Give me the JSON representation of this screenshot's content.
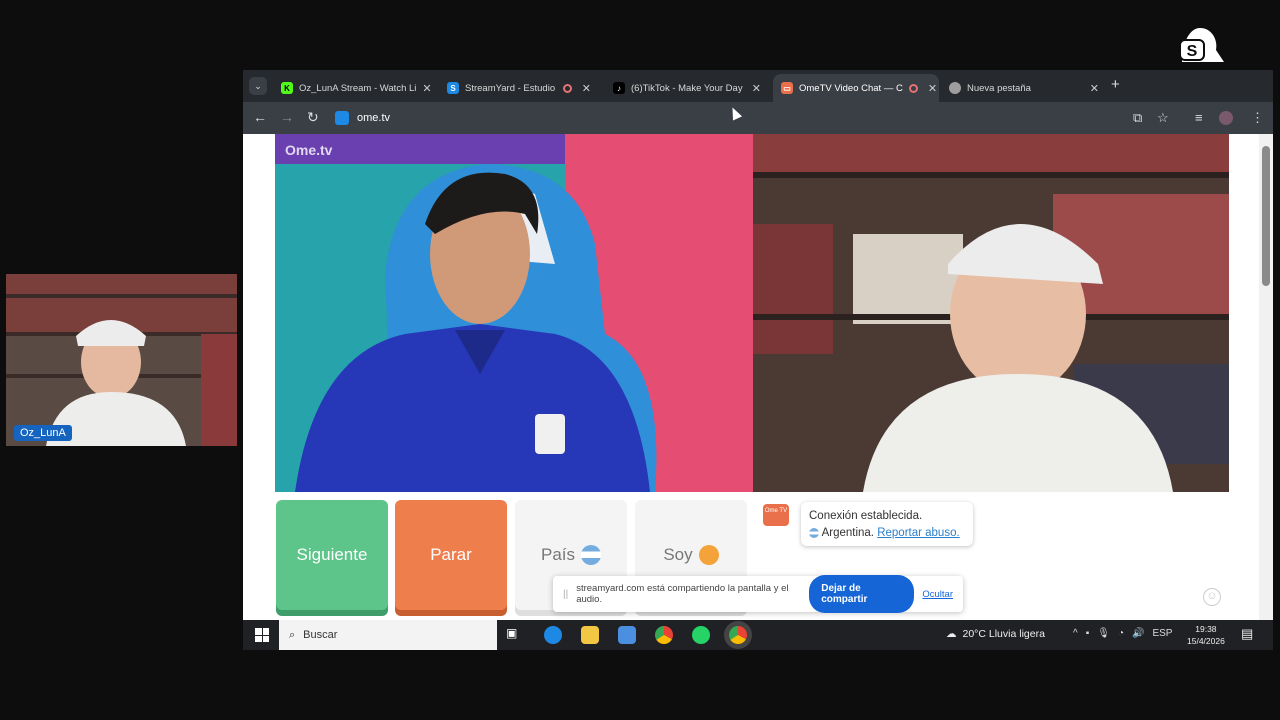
{
  "brand": {
    "streamyard_label": "streamyard"
  },
  "webcam": {
    "name_tag": "Oz_LunA"
  },
  "tabs": [
    {
      "label": "Oz_LunA Stream - Watch Li",
      "icon": "kick-icon",
      "color": "#53fc18"
    },
    {
      "label": "StreamYard - Estudio",
      "icon": "streamyard-icon",
      "color": "#1e88e5"
    },
    {
      "label": "(6)TikTok - Make Your Day",
      "icon": "tiktok-icon",
      "color": "#000000"
    },
    {
      "label": "OmeTV Video Chat — C",
      "icon": "ometv-icon",
      "color": "#e9704a"
    },
    {
      "label": "Nueva pestaña",
      "icon": "chrome-icon",
      "color": "#9e9e9e"
    }
  ],
  "toolbar": {
    "url": "ome.tv"
  },
  "ometv": {
    "watermark": "Ome.tv",
    "next_label": "Siguiente",
    "stop_label": "Parar",
    "country_label": "País",
    "iam_label": "Soy"
  },
  "chat": {
    "logo_text": "Ome TV",
    "connection": "Conexión establecida.",
    "country": "Argentina.",
    "report": "Reportar abuso."
  },
  "share_bar": {
    "message": "streamyard.com está compartiendo la pantalla y el audio.",
    "stop_label": "Dejar de compartir",
    "hide_label": "Ocultar"
  },
  "taskbar": {
    "search_label": "Buscar",
    "weather": "20°C  Lluvia ligera",
    "lang": "ESP",
    "time": "19:38",
    "date": "15/4/2026"
  },
  "colors": {
    "accent_blue": "#1565d6",
    "next_green": "#5dc48a",
    "stop_orange": "#ef7e4d"
  }
}
